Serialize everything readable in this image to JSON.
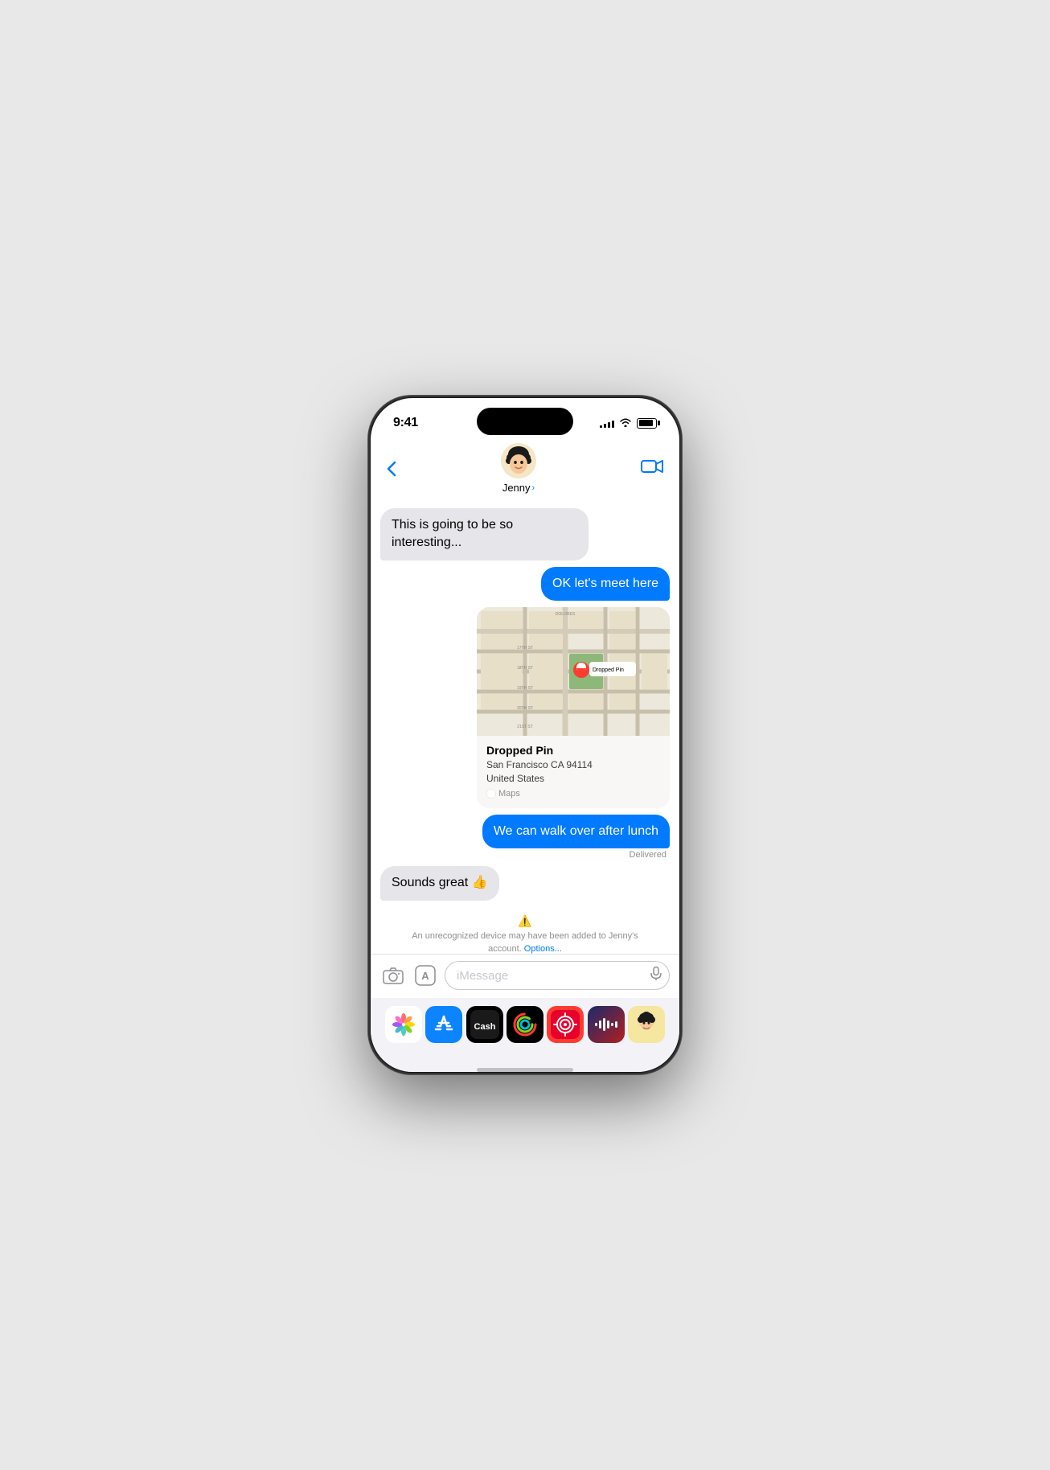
{
  "status": {
    "time": "9:41",
    "signal_bars": [
      3,
      5,
      7,
      9,
      11
    ],
    "battery_level": 85
  },
  "header": {
    "back_label": "‹",
    "contact_name": "Jenny",
    "contact_chevron": "›",
    "video_call_label": "📹"
  },
  "messages": [
    {
      "id": "msg1",
      "type": "received",
      "text": "This is going to be so interesting..."
    },
    {
      "id": "msg2",
      "type": "sent",
      "text": "OK let's meet here"
    },
    {
      "id": "msg3",
      "type": "sent_map",
      "map_title": "Dropped Pin",
      "map_address": "San Francisco CA 94114\nUnited States",
      "map_provider": "Maps"
    },
    {
      "id": "msg4",
      "type": "sent",
      "text": "We can walk over after lunch",
      "status": "Delivered"
    },
    {
      "id": "msg5",
      "type": "received",
      "text": "Sounds great 👍"
    }
  ],
  "warning": {
    "text": "An unrecognized device may have been added to Jenny's account.",
    "link_text": "Options..."
  },
  "input": {
    "placeholder": "iMessage"
  },
  "app_tray": {
    "apps": [
      {
        "name": "Photos",
        "emoji": "🌸"
      },
      {
        "name": "App Store",
        "emoji": "A"
      },
      {
        "name": "Apple Cash",
        "emoji": ""
      },
      {
        "name": "Activity",
        "emoji": ""
      },
      {
        "name": "Search",
        "emoji": "🔍"
      },
      {
        "name": "SoundCloud",
        "emoji": "🎵"
      },
      {
        "name": "Memoji",
        "emoji": "😊"
      }
    ]
  },
  "colors": {
    "sent_bubble": "#007AFF",
    "received_bubble": "#e5e5ea",
    "background": "#ffffff",
    "accent": "#007AFF"
  }
}
